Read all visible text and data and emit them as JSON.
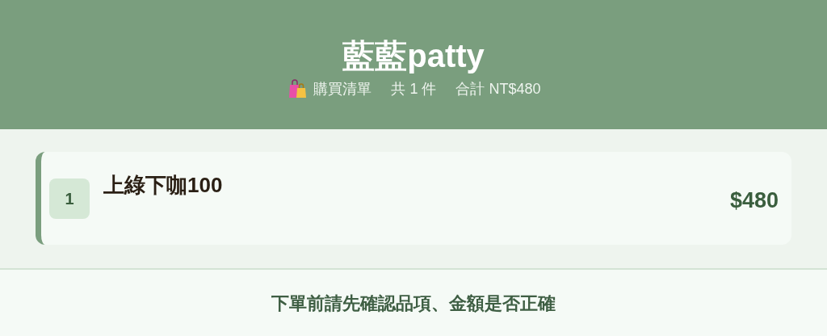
{
  "header": {
    "title": "藍藍patty",
    "list_label": "購買清單",
    "count": "共 1 件",
    "total": "合計 NT$480"
  },
  "items": [
    {
      "index": "1",
      "name": "上綠下咖100",
      "price": "$480"
    }
  ],
  "footer": {
    "notice": "下單前請先確認品項、金額是否正確"
  }
}
